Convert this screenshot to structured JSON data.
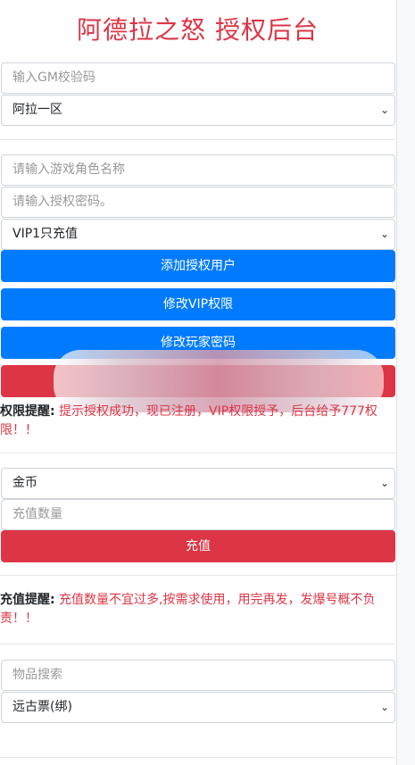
{
  "header": {
    "title": "阿德拉之怒 授权后台"
  },
  "gm_section": {
    "gm_code_placeholder": "输入GM校验码",
    "server_select": "阿拉一区"
  },
  "auth_section": {
    "role_name_placeholder": "请输入游戏角色名称",
    "auth_password_placeholder": "请输入授权密码。",
    "vip_select": "VIP1只充值",
    "add_auth_user_label": "添加授权用户",
    "modify_vip_label": "修改VIP权限",
    "modify_player_password_label": "修改玩家密码",
    "notice_label": "权限提醒:",
    "notice_text": "提示授权成功，现已注册，VIP权限授予，后台给予777权限！！"
  },
  "recharge_section": {
    "currency_select": "金币",
    "amount_placeholder": "充值数量",
    "recharge_label": "充值",
    "notice_label": "充值提醒:",
    "notice_text": "充值数量不宜过多,按需求使用，用完再发，发爆号概不负责！！"
  },
  "item_section": {
    "search_placeholder": "物品搜索",
    "item_select": "远古票(绑)"
  },
  "icons": {
    "dropdown": "chevron-down-icon"
  },
  "colors": {
    "primary": "#007bff",
    "danger": "#dc3545"
  }
}
